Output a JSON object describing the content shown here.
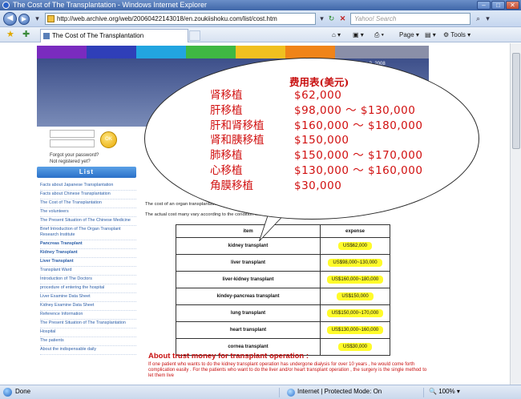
{
  "window": {
    "title": "The Cost of The Transplantation - Windows Internet Explorer"
  },
  "address_bar": {
    "url": "http://web.archive.org/web/20060422143018/en.zoukiishoku.com/list/cost.htm",
    "search_placeholder": "Yahoo! Search"
  },
  "tab_bar": {
    "tab_title": "The Cost of The Transplantation",
    "page_menu": "Page",
    "tools_menu": "Tools"
  },
  "site": {
    "colorbar": [
      "#7a2bbf",
      "#2f3fb8",
      "#22a5e0",
      "#3fb843",
      "#f0c020",
      "#f08418",
      "#8a8fa8",
      "#8a8fa8"
    ],
    "date": "June 3, 2008",
    "ok_button": "OK",
    "forgot_password": "Forgot your password?",
    "not_registered": "Not registered yet?",
    "list_header": "List",
    "sidebar_links": [
      {
        "text": "Facts about Japanese Transplantation",
        "bold": false
      },
      {
        "text": "Facts about Chinese Transplantation",
        "bold": false
      },
      {
        "text": "The Cost of The Transplantation",
        "bold": false
      },
      {
        "text": "The volunteers",
        "bold": false
      },
      {
        "text": "The Present Situation of The Chinese Medicine",
        "bold": false
      },
      {
        "text": "Brief Introduction of The Organ Transplant Research Institute",
        "bold": false
      },
      {
        "text": "Pancreas Transplant",
        "bold": true
      },
      {
        "text": "Kidney Transplant",
        "bold": true
      },
      {
        "text": "Liver Transplant",
        "bold": true
      },
      {
        "text": "Transplant Ward",
        "bold": false
      },
      {
        "text": "Introduction of The Doctors",
        "bold": false
      },
      {
        "text": "procedure of entering the hospital",
        "bold": false
      },
      {
        "text": "Liver Examine Data Sheet",
        "bold": false
      },
      {
        "text": "Kidney Examine Data Sheet",
        "bold": false
      },
      {
        "text": "Reference Information",
        "bold": false
      },
      {
        "text": "The Present Situation of The Transplantation",
        "bold": false
      },
      {
        "text": "Hospital",
        "bold": false
      },
      {
        "text": "The patients",
        "bold": false
      },
      {
        "text": "About the indispensable daily",
        "bold": false
      }
    ],
    "intro_line1": "The cost of an organ transplantation in China is given in the following table (US dollars).",
    "intro_line2": "The actual cost many vary according to the condition of the patient. Please see the expense table.",
    "table": {
      "headers": [
        "item",
        "expense"
      ],
      "rows": [
        {
          "item": "kidney transplant",
          "expense": "US$62,000"
        },
        {
          "item": "liver transplant",
          "expense": "US$98,000~130,000"
        },
        {
          "item": "liver-kidney transplant",
          "expense": "US$160,000~180,000"
        },
        {
          "item": "kindey-pancreas transplant",
          "expense": "US$150,000"
        },
        {
          "item": "lung transplant",
          "expense": "US$150,000~170,000"
        },
        {
          "item": "heart transplant",
          "expense": "US$130,000~160,000"
        },
        {
          "item": "cornea transplant",
          "expense": "US$30,000"
        }
      ]
    },
    "trust_title": "About trust money for transplant operation :",
    "trust_body": "If one patient who wants to do the kidney transplant operation has undergone dialysis for over 10 years , he would come forth complication easily . For the patients who want to do the liver and/or heart transplant operation , the surgery is the single method to let them live"
  },
  "bubble": {
    "title": "费用表(美元)",
    "rows": [
      {
        "organ": "肾移植",
        "price": "$62,000"
      },
      {
        "organ": "肝移植",
        "price": "$98,000 ～ $130,000"
      },
      {
        "organ": "肝和肾移植",
        "price": "$160,000 ～ $180,000"
      },
      {
        "organ": "肾和胰移植",
        "price": "$150,000"
      },
      {
        "organ": "肺移植",
        "price": "$150,000 ～ $170,000"
      },
      {
        "organ": "心移植",
        "price": "$130,000 ～ $160,000"
      },
      {
        "organ": "角膜移植",
        "price": "$30,000"
      }
    ]
  },
  "status_bar": {
    "status": "Done",
    "zone": "Internet | Protected Mode: On",
    "zoom": "100%"
  }
}
